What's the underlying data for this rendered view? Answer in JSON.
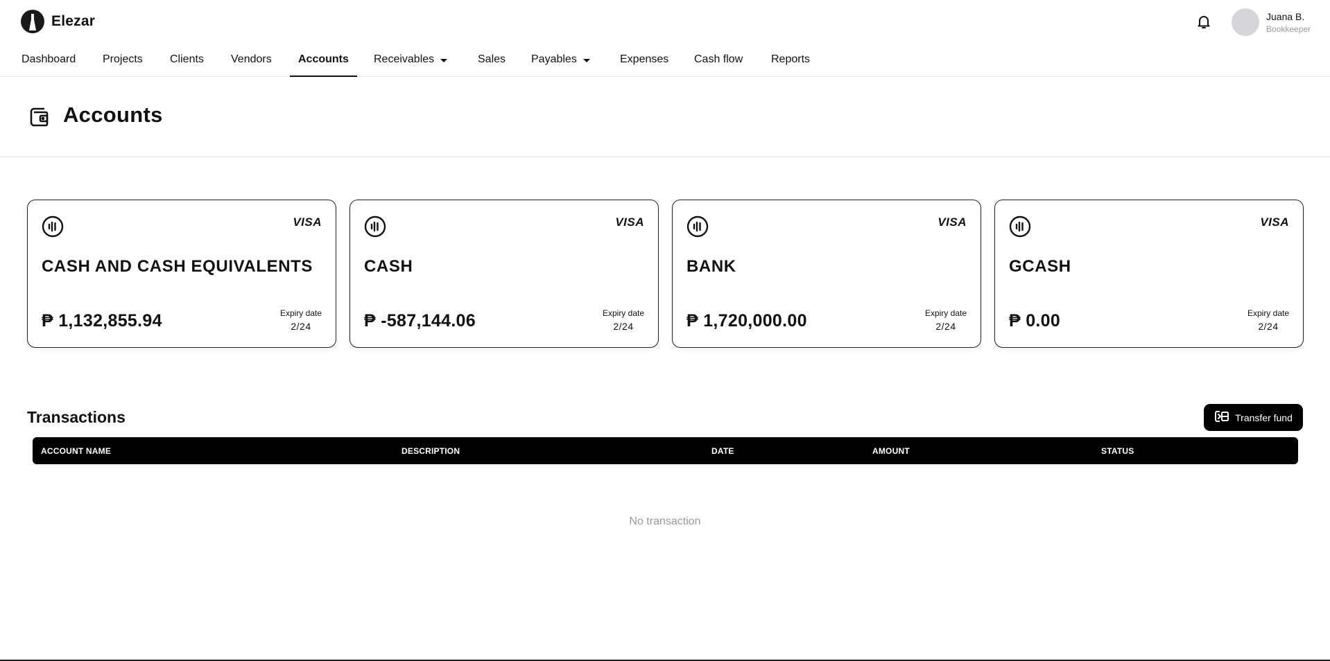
{
  "brand": {
    "name": "Elezar",
    "logo_icon": "brand-logo-icon"
  },
  "header": {
    "notifications_icon": "bell-icon",
    "user": {
      "name": "Juana B.",
      "role": "Bookkeeper"
    }
  },
  "nav": {
    "items": [
      {
        "label": "Dashboard"
      },
      {
        "label": "Projects"
      },
      {
        "label": "Clients"
      },
      {
        "label": "Vendors"
      },
      {
        "label": "Accounts",
        "active": true
      },
      {
        "label": "Receivables",
        "dropdown": true
      },
      {
        "label": "Sales"
      },
      {
        "label": "Payables",
        "dropdown": true
      },
      {
        "label": "Expenses"
      },
      {
        "label": "Cash flow"
      },
      {
        "label": "Reports"
      }
    ]
  },
  "page": {
    "title": "Accounts",
    "icon": "wallet-icon"
  },
  "cards": [
    {
      "name": "CASH AND CASH EQUIVALENTS",
      "network": "VISA",
      "balance": "₱ 1,132,855.94",
      "expiry_label": "Expiry date",
      "expiry": "2/24"
    },
    {
      "name": "CASH",
      "network": "VISA",
      "balance": "₱ -587,144.06",
      "expiry_label": "Expiry date",
      "expiry": "2/24"
    },
    {
      "name": "BANK",
      "network": "VISA",
      "balance": "₱ 1,720,000.00",
      "expiry_label": "Expiry date",
      "expiry": "2/24"
    },
    {
      "name": "GCASH",
      "network": "VISA",
      "balance": "₱ 0.00",
      "expiry_label": "Expiry date",
      "expiry": "2/24"
    }
  ],
  "transactions": {
    "title": "Transactions",
    "transfer_label": "Transfer fund",
    "columns": [
      "ACCOUNT NAME",
      "DESCRIPTION",
      "DATE",
      "AMOUNT",
      "STATUS"
    ],
    "rows": [],
    "empty_text": "No transaction"
  },
  "colors": {
    "primary": "#000000",
    "muted_text": "#9a9a9a",
    "avatar": "#d6d6da",
    "divider": "#e6e6e6"
  }
}
